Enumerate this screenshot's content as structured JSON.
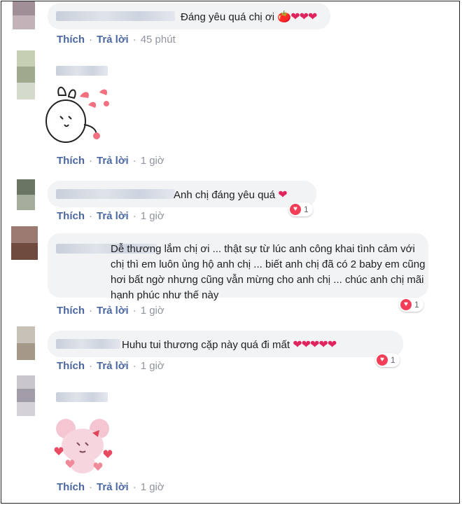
{
  "actions": {
    "like": "Thích",
    "reply": "Trả lời",
    "separator": "·"
  },
  "comments": [
    {
      "text": "Đáng yêu quá chị ơi",
      "emoji": "🍅❤❤❤",
      "time": "45 phút"
    },
    {
      "type": "sticker",
      "sticker_icon": "bunny-sticker",
      "time": "1 giờ"
    },
    {
      "text": "Anh chị đáng yêu quá",
      "emoji": "❤",
      "time": "1 giờ",
      "reactions": "1"
    },
    {
      "text": "Dễ thương lắm chị ơi ... thật sự từ lúc anh công khai tình cảm với chị thì em luôn ủng hộ anh chị ... biết anh chị đã có 2 baby em cũng hơi bất ngờ nhưng cũng vẫn mừng cho anh chị ... chúc anh chị mãi hạnh phúc như thế này",
      "time": "1 giờ",
      "reactions": "1"
    },
    {
      "text": "Huhu tui thương cặp này quá đi mất",
      "emoji": "❤❤❤❤❤",
      "time": "1 giờ",
      "reactions": "1"
    },
    {
      "type": "sticker",
      "sticker_icon": "pink-bear-sticker",
      "time": "1 giờ"
    }
  ],
  "colors": {
    "link": "#4b67a1",
    "meta": "#90949c",
    "bubble": "#f2f3f5",
    "heart": "#e0245e"
  }
}
